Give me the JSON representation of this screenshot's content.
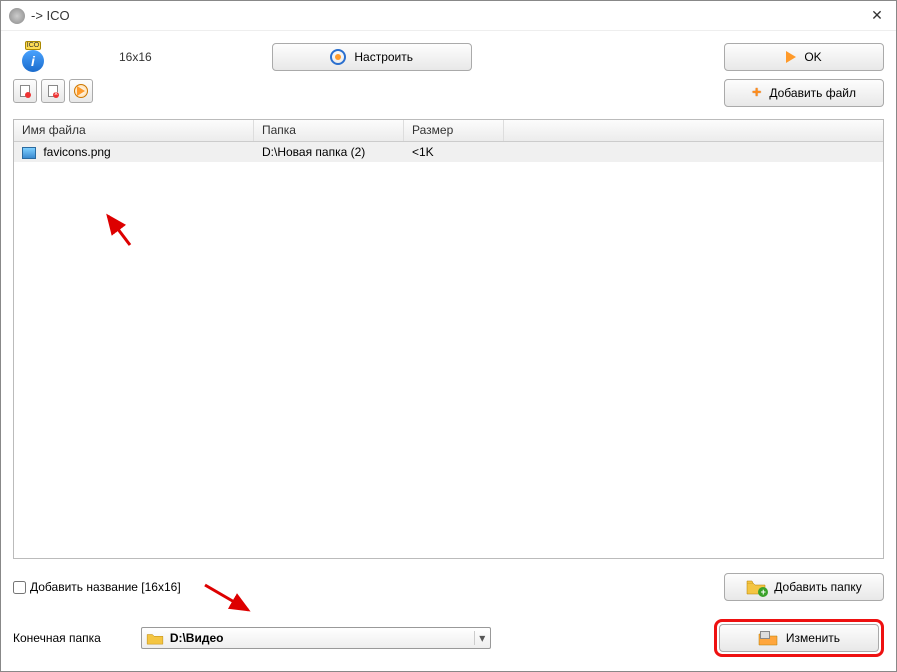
{
  "window": {
    "title": "-> ICO"
  },
  "toolbar": {
    "dimensions": "16x16",
    "configure": "Настроить",
    "ok": "OK",
    "add_file": "Добавить файл",
    "ico_badge": "ICO",
    "info_glyph": "i"
  },
  "columns": {
    "name": "Имя файла",
    "folder": "Папка",
    "size": "Размер"
  },
  "files": [
    {
      "name": "favicons.png",
      "folder": "D:\\Новая папка (2)",
      "size": "<1K"
    }
  ],
  "options": {
    "add_name_label": "Добавить название [16x16]"
  },
  "destination": {
    "label": "Конечная папка",
    "path": "D:\\Видео"
  },
  "actions": {
    "add_folder": "Добавить папку",
    "change": "Изменить"
  }
}
